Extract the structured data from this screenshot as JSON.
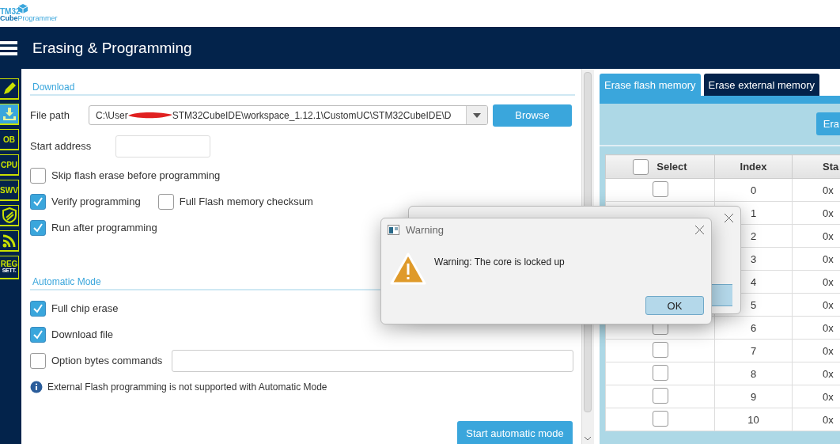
{
  "logo": {
    "line1": "TM32",
    "line2a": "Cube",
    "line2b": "Programmer"
  },
  "header": {
    "title": "Erasing & Programming"
  },
  "sidebar": {
    "items": [
      {
        "kind": "pencil",
        "selected": false
      },
      {
        "kind": "download",
        "selected": true
      },
      {
        "kind": "text",
        "label": "OB",
        "selected": false
      },
      {
        "kind": "text",
        "label": "CPU",
        "selected": false
      },
      {
        "kind": "text",
        "label": "SWV",
        "selected": false
      },
      {
        "kind": "shield",
        "selected": false
      },
      {
        "kind": "signal",
        "selected": false
      },
      {
        "kind": "reg",
        "label": "REG",
        "sublabel": "SETT.",
        "selected": false
      }
    ]
  },
  "download": {
    "heading": "Download",
    "file_path_label": "File path",
    "file_path_start": "C:\\User",
    "file_path_end": "STM32CubeIDE\\workspace_1.12.1\\CustomUC\\STM32CubeIDE\\D",
    "browse": "Browse",
    "start_address_label": "Start address",
    "options": [
      {
        "label": "Skip flash erase before programming",
        "checked": false
      },
      {
        "label": "Verify programming",
        "checked": true
      },
      {
        "label": "Full Flash memory checksum",
        "checked": false
      },
      {
        "label": "Run after programming",
        "checked": true
      }
    ]
  },
  "automatic_mode": {
    "heading": "Automatic Mode",
    "options": [
      {
        "label": "Full chip erase",
        "checked": true
      },
      {
        "label": "Download file",
        "checked": true
      },
      {
        "label": "Option bytes commands",
        "checked": false
      }
    ],
    "info": "External Flash programming is not supported with Automatic Mode",
    "start_button": "Start automatic mode"
  },
  "erase_panel": {
    "tabs": [
      {
        "label": "Erase flash memory",
        "selected": true
      },
      {
        "label": "Erase external memory",
        "selected": false
      }
    ],
    "erase_button": "Era",
    "table": {
      "columns": [
        "Select",
        "Index",
        "Sta"
      ],
      "select_all": false,
      "rows": [
        {
          "checked": false,
          "index": "0",
          "column_3": "0x"
        },
        {
          "index": "1",
          "column_3": "0x"
        },
        {
          "index": "2",
          "column_3": "0x"
        },
        {
          "index": "3",
          "column_3": "0x"
        },
        {
          "index": "4",
          "column_3": "0x"
        },
        {
          "index": "5",
          "column_3": "0x"
        },
        {
          "checked": false,
          "index": "6",
          "column_3": "0x"
        },
        {
          "checked": false,
          "index": "7",
          "column_3": "0x"
        },
        {
          "checked": false,
          "index": "8",
          "column_3": "0x"
        },
        {
          "checked": false,
          "index": "9",
          "column_3": "0x"
        },
        {
          "checked": false,
          "index": "10",
          "column_3": "0x"
        }
      ]
    }
  },
  "warning_dialog": {
    "title": "Warning",
    "message": "Warning: The core is locked up",
    "ok": "OK"
  }
}
